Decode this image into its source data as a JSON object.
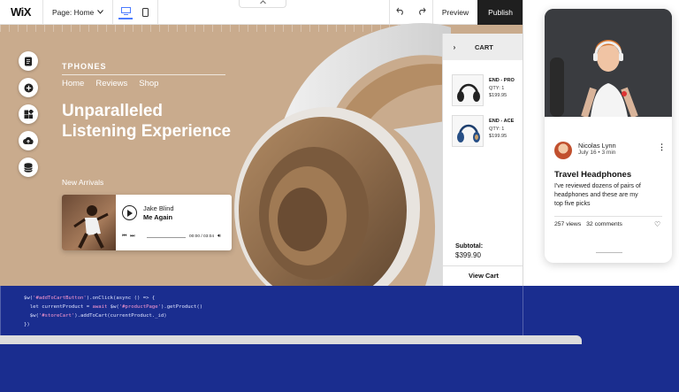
{
  "topbar": {
    "logo": "WiX",
    "page_selector": "Page: Home",
    "preview_label": "Preview",
    "publish_label": "Publish"
  },
  "site": {
    "brand": "TPHONES",
    "nav": [
      "Home",
      "Reviews",
      "Shop"
    ],
    "hero_line1": "Unparalleled",
    "hero_line2": "Listening Experience",
    "section_label": "New Arrivals"
  },
  "player": {
    "artist": "Jake Blind",
    "song": "Me Again",
    "time": "00:00 / 03:04"
  },
  "cart": {
    "title": "CART",
    "items": [
      {
        "name": "END - PRO",
        "qty": "QTY: 1",
        "price": "$199.95"
      },
      {
        "name": "END - ACE",
        "qty": "QTY: 1",
        "price": "$199.95"
      }
    ],
    "subtotal_label": "Subtotal:",
    "subtotal_value": "$399.90",
    "view_cart": "View Cart"
  },
  "code": {
    "line1_a": "$w(",
    "line1_s": "'#addToCartButton'",
    "line1_b": ").onClick(async () => {",
    "line2_a": "  let currentProduct = ",
    "line2_k": "await",
    "line2_b": " $w(",
    "line2_s": "'#productPage'",
    "line2_c": ").getProduct()",
    "line3_a": "  $w(",
    "line3_s": "'#storeCart'",
    "line3_b": ").addToCart(currentProduct._id)",
    "line4": "})"
  },
  "phone": {
    "author": "Nicolas Lynn",
    "meta": "July 16 • 3 min",
    "title": "Travel Headphones",
    "body": "I've reviewed dozens of pairs of headphones and these are my top five picks",
    "views": "257 views",
    "comments": "32 comments"
  },
  "colors": {
    "hero_bg": "#c9ab8d",
    "band": "#1a2d8f",
    "publish_bg": "#1f1f1f",
    "accent": "#4b7bff"
  }
}
